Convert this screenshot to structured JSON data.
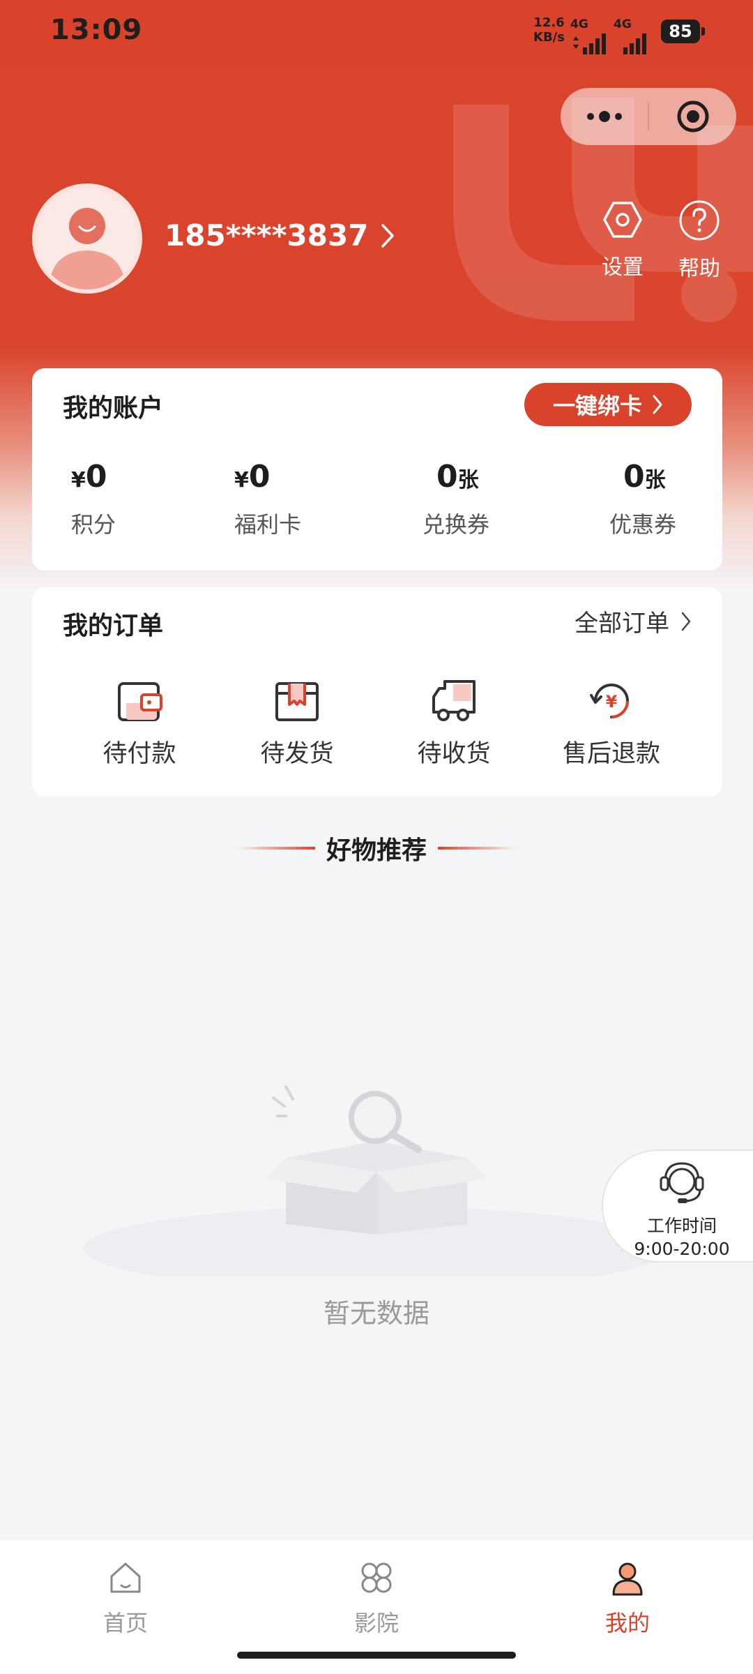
{
  "colors": {
    "accent": "#d9432b",
    "background": "#f4f5f7",
    "text_muted": "#999999"
  },
  "status_bar": {
    "time": "13:09",
    "net_speed_value": "12.6",
    "net_speed_unit": "KB/s",
    "network_1": "4G",
    "network_2": "4G",
    "battery": "85"
  },
  "profile": {
    "phone": "185****3837"
  },
  "header_actions": {
    "settings_label": "设置",
    "help_label": "帮助"
  },
  "account": {
    "title": "我的账户",
    "bind_card_label": "一键绑卡",
    "items": [
      {
        "prefix": "¥",
        "value": "0",
        "suffix": "",
        "label": "积分"
      },
      {
        "prefix": "¥",
        "value": "0",
        "suffix": "",
        "label": "福利卡"
      },
      {
        "prefix": "",
        "value": "0",
        "suffix": "张",
        "label": "兑换券"
      },
      {
        "prefix": "",
        "value": "0",
        "suffix": "张",
        "label": "优惠券"
      }
    ]
  },
  "orders": {
    "title": "我的订单",
    "all_orders_label": "全部订单",
    "items": [
      {
        "icon": "wallet-icon",
        "label": "待付款"
      },
      {
        "icon": "package-icon",
        "label": "待发货"
      },
      {
        "icon": "truck-icon",
        "label": "待收货"
      },
      {
        "icon": "refund-icon",
        "label": "售后退款"
      }
    ]
  },
  "recommend": {
    "title": "好物推荐",
    "empty_text": "暂无数据"
  },
  "service": {
    "line1": "工作时间",
    "line2": "9:00-20:00"
  },
  "tabbar": {
    "items": [
      {
        "icon": "home-icon",
        "label": "首页",
        "active": false
      },
      {
        "icon": "cinema-icon",
        "label": "影院",
        "active": false
      },
      {
        "icon": "profile-icon",
        "label": "我的",
        "active": true
      }
    ]
  }
}
